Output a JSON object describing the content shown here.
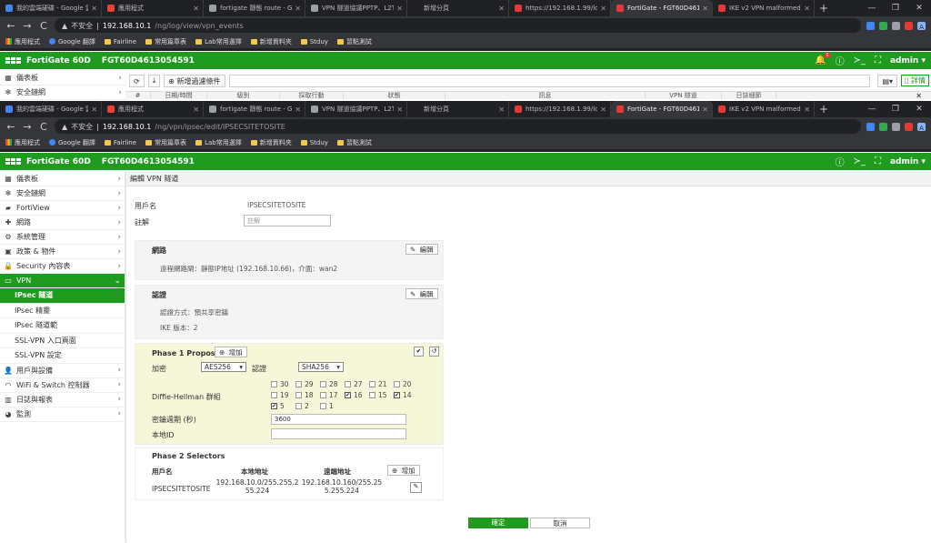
{
  "browser": {
    "tabs": [
      {
        "title": "我的雲端硬碟 - Google 雲",
        "color": "#4285f4"
      },
      {
        "title": "應用程式",
        "color": "#ea4335"
      },
      {
        "title": "fortigate 靜態 route - Go",
        "color": "#9aa0a6"
      },
      {
        "title": "VPN 隧道協議PPTP、L2TP",
        "color": "#9aa0a6"
      },
      {
        "title": "新增分頁",
        "color": "#202124"
      },
      {
        "title": "https://192.168.1.99/log",
        "color": "#e53935"
      },
      {
        "title": "FortiGate - FGT60D4613",
        "color": "#e53935"
      },
      {
        "title": "IKE v2 VPN malformed",
        "color": "#e53935"
      }
    ],
    "active_tab_index": 6,
    "new_tab_label": "+",
    "win_controls": [
      "—",
      "❐",
      "✕"
    ],
    "top_url": {
      "warning": "不安全",
      "host": "192.168.10.1",
      "path": "/ng/log/view/vpn_events"
    },
    "url": {
      "warning": "不安全",
      "host": "192.168.10.1",
      "path": "/ng/vpn/ipsec/edit/IPSECSITETOSITE"
    },
    "nav": {
      "back": "←",
      "forward": "→",
      "reload": "C"
    },
    "profile_initial": "A",
    "bookmarks": [
      {
        "label": "應用程式",
        "icon": "apps-grid"
      },
      {
        "label": "Google 翻譯",
        "icon": "google-translate"
      },
      {
        "label": "Fairline",
        "icon": "folder"
      },
      {
        "label": "常用篇章表",
        "icon": "folder"
      },
      {
        "label": "Lab常用選擇",
        "icon": "folder"
      },
      {
        "label": "新增資料夾",
        "icon": "folder"
      },
      {
        "label": "Stduy",
        "icon": "folder"
      },
      {
        "label": "習點測試",
        "icon": "folder"
      }
    ]
  },
  "fortigate": {
    "product": "FortiGate 60D",
    "serial": "FGT60D4613054591",
    "notification_count": "1",
    "user": "admin",
    "header_icons": [
      "bell-icon",
      "help-icon",
      "terminal-icon",
      "fullscreen-icon"
    ]
  },
  "old_view": {
    "sidebar": [
      {
        "label": "儀表板",
        "icon": "dashboard-icon"
      },
      {
        "label": "安全鏈網",
        "icon": "security-fabric-icon"
      }
    ],
    "toolbar": {
      "add_filter": "新增過濾條件",
      "details": "詳情"
    },
    "columns": [
      "#",
      "日期/時間",
      "級別",
      "採取行動",
      "狀態",
      "訊息",
      "VPN 隧道",
      "日誌細節"
    ]
  },
  "sidebar": {
    "items": [
      {
        "label": "儀表板",
        "icon": "dashboard-icon",
        "chevron": "›"
      },
      {
        "label": "安全鏈網",
        "icon": "security-fabric-icon",
        "chevron": "›"
      },
      {
        "label": "FortiView",
        "icon": "fortiview-icon",
        "chevron": "›"
      },
      {
        "label": "網路",
        "icon": "network-icon",
        "chevron": "›"
      },
      {
        "label": "系統管理",
        "icon": "gear-icon",
        "chevron": "›"
      },
      {
        "label": "政策 & 物件",
        "icon": "policy-icon",
        "chevron": "›"
      },
      {
        "label": "Security 內容表",
        "icon": "lock-icon",
        "chevron": "›"
      },
      {
        "label": "VPN",
        "icon": "vpn-icon",
        "chevron": "⌄",
        "active": true
      }
    ],
    "vpn_sub": [
      {
        "label": "IPsec 隧道",
        "selected": true,
        "star": "☆"
      },
      {
        "label": "IPsec 精靈"
      },
      {
        "label": "IPsec 隧道範"
      },
      {
        "label": "SSL-VPN 入口頁面"
      },
      {
        "label": "SSL-VPN 設定"
      }
    ],
    "items_after": [
      {
        "label": "用戶與設備",
        "icon": "user-icon",
        "chevron": "›"
      },
      {
        "label": "WiFi & Switch 控制器",
        "icon": "wifi-icon",
        "chevron": "›"
      },
      {
        "label": "日誌與報表",
        "icon": "report-icon",
        "chevron": "›"
      },
      {
        "label": "監測",
        "icon": "monitor-icon",
        "chevron": "›"
      }
    ]
  },
  "main": {
    "breadcrumb": "編輯 VPN 隧道",
    "name_label": "用戶名",
    "name_value": "IPSECSITETOSITE",
    "comment_label": "註解",
    "comment_placeholder": "註解",
    "network": {
      "title": "網路",
      "edit": "編輯",
      "detail": "遠程網路閘：靜態IP地址 (192.168.10.66)，介面：wan2"
    },
    "auth": {
      "title": "認證",
      "edit": "編輯",
      "method": "認證方式：預共享密鑰",
      "ike": "IKE 版本：2"
    },
    "phase1": {
      "title": "Phase 1 Proposal",
      "add": "增加",
      "encryption_label": "加密",
      "encryption_value": "AES256",
      "auth_label": "認證",
      "auth_value": "SHA256",
      "dh_label": "Diffie-Hellman 群組",
      "dh_groups": [
        {
          "n": "30",
          "on": false
        },
        {
          "n": "29",
          "on": false
        },
        {
          "n": "28",
          "on": false
        },
        {
          "n": "27",
          "on": false
        },
        {
          "n": "21",
          "on": false
        },
        {
          "n": "20",
          "on": false
        },
        {
          "n": "19",
          "on": false
        },
        {
          "n": "18",
          "on": false
        },
        {
          "n": "17",
          "on": false
        },
        {
          "n": "16",
          "on": true
        },
        {
          "n": "15",
          "on": false
        },
        {
          "n": "14",
          "on": true
        },
        {
          "n": "5",
          "on": true
        },
        {
          "n": "2",
          "on": false
        },
        {
          "n": "1",
          "on": false
        }
      ],
      "key_lifetime_label": "密鑰週期 (秒)",
      "key_lifetime_value": "3600",
      "local_id_label": "本地ID",
      "local_id_value": ""
    },
    "phase2": {
      "title": "Phase 2 Selectors",
      "col_name": "用戶名",
      "col_local": "本地地址",
      "col_remote": "遠端地址",
      "add": "增加",
      "rows": [
        {
          "name": "IPSECSITETOSITE",
          "local": "192.168.10.0/255.255.255.224",
          "remote": "192.168.10.160/255.255.255.224"
        }
      ]
    },
    "ok": "確定",
    "cancel": "取消"
  }
}
